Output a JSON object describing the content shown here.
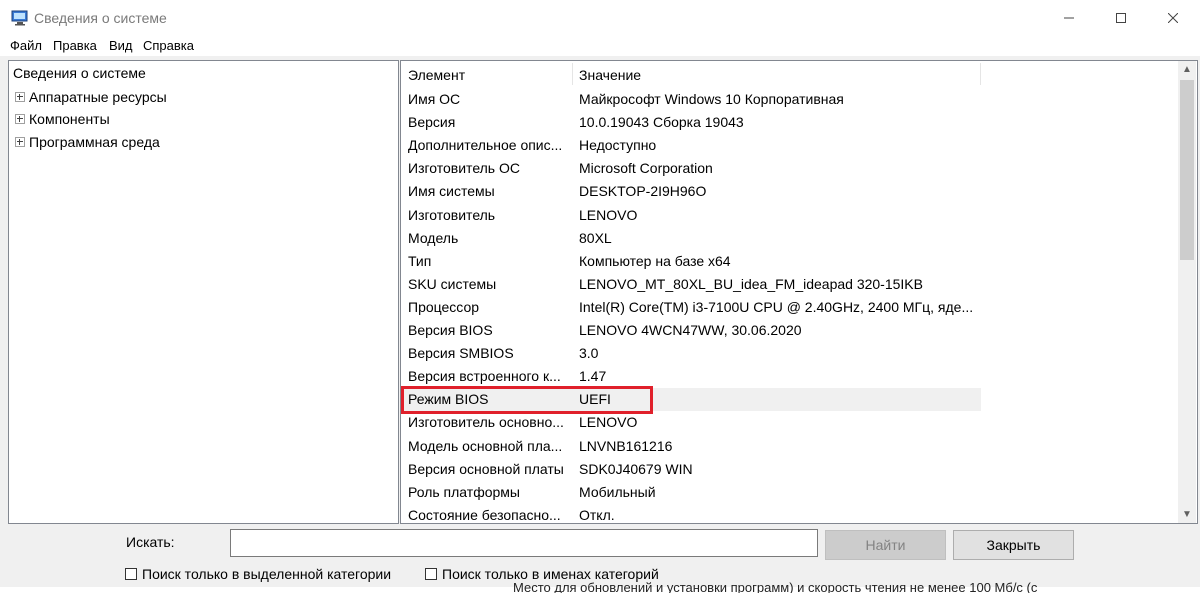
{
  "window": {
    "title": "Сведения о системе"
  },
  "menu": [
    "Файл",
    "Правка",
    "Вид",
    "Справка"
  ],
  "tree": {
    "root": "Сведения о системе",
    "items": [
      "Аппаратные ресурсы",
      "Компоненты",
      "Программная среда"
    ]
  },
  "list": {
    "headers": {
      "element": "Элемент",
      "value": "Значение"
    },
    "rows": [
      {
        "element": "Имя ОС",
        "value": "Майкрософт Windows 10 Корпоративная"
      },
      {
        "element": "Версия",
        "value": "10.0.19043 Сборка 19043"
      },
      {
        "element": "Дополнительное опис...",
        "value": "Недоступно"
      },
      {
        "element": "Изготовитель ОС",
        "value": "Microsoft Corporation"
      },
      {
        "element": "Имя системы",
        "value": "DESKTOP-2I9H96O"
      },
      {
        "element": "Изготовитель",
        "value": "LENOVO"
      },
      {
        "element": "Модель",
        "value": "80XL"
      },
      {
        "element": "Тип",
        "value": "Компьютер на базе x64"
      },
      {
        "element": "SKU системы",
        "value": "LENOVO_MT_80XL_BU_idea_FM_ideapad 320-15IKB"
      },
      {
        "element": "Процессор",
        "value": "Intel(R) Core(TM) i3-7100U CPU @ 2.40GHz, 2400 МГц, яде..."
      },
      {
        "element": "Версия BIOS",
        "value": "LENOVO 4WCN47WW, 30.06.2020"
      },
      {
        "element": "Версия SMBIOS",
        "value": "3.0"
      },
      {
        "element": "Версия встроенного к...",
        "value": "1.47"
      },
      {
        "element": "Режим BIOS",
        "value": "UEFI"
      },
      {
        "element": "Изготовитель основно...",
        "value": "LENOVO"
      },
      {
        "element": "Модель основной пла...",
        "value": "LNVNB161216"
      },
      {
        "element": "Версия основной платы",
        "value": "SDK0J40679 WIN"
      },
      {
        "element": "Роль платформы",
        "value": "Мобильный"
      },
      {
        "element": "Состояние безопасно...",
        "value": "Откл."
      }
    ],
    "selected_index": 13
  },
  "search": {
    "label": "Искать:",
    "value": "",
    "find_button": "Найти",
    "close_button": "Закрыть",
    "option1": "Поиск только в выделенной категории",
    "option2": "Поиск только в именах категорий"
  },
  "background_text": "Место для обновлений и установки программ) и скорость чтения не менее 100 Мб/с (с",
  "colors": {
    "highlight_border": "#e0202b",
    "selected_row": "#f0f0f0"
  }
}
